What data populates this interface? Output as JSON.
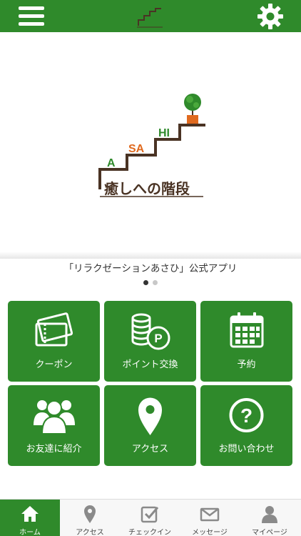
{
  "caption": "「リラクゼーションあさひ」公式アプリ",
  "logo": {
    "letters": [
      "A",
      "SA",
      "HI"
    ],
    "tagline": "癒しへの階段"
  },
  "carousel": {
    "current": 1,
    "total": 2
  },
  "grid": [
    {
      "label": "クーポン",
      "icon": "coupon-tickets-icon"
    },
    {
      "label": "ポイント交換",
      "icon": "coins-points-icon"
    },
    {
      "label": "予約",
      "icon": "calendar-icon"
    },
    {
      "label": "お友達に紹介",
      "icon": "friends-group-icon"
    },
    {
      "label": "アクセス",
      "icon": "map-pin-icon"
    },
    {
      "label": "お問い合わせ",
      "icon": "question-icon"
    }
  ],
  "tabs": [
    {
      "label": "ホーム",
      "icon": "home-icon",
      "active": true
    },
    {
      "label": "アクセス",
      "icon": "map-pin-icon",
      "active": false
    },
    {
      "label": "チェックイン",
      "icon": "checkin-icon",
      "active": false
    },
    {
      "label": "メッセージ",
      "icon": "envelope-icon",
      "active": false
    },
    {
      "label": "マイページ",
      "icon": "user-icon",
      "active": false
    }
  ],
  "colors": {
    "brand": "#2f8a2b",
    "logo_orange": "#e06a1f",
    "logo_brown": "#4a3324"
  }
}
